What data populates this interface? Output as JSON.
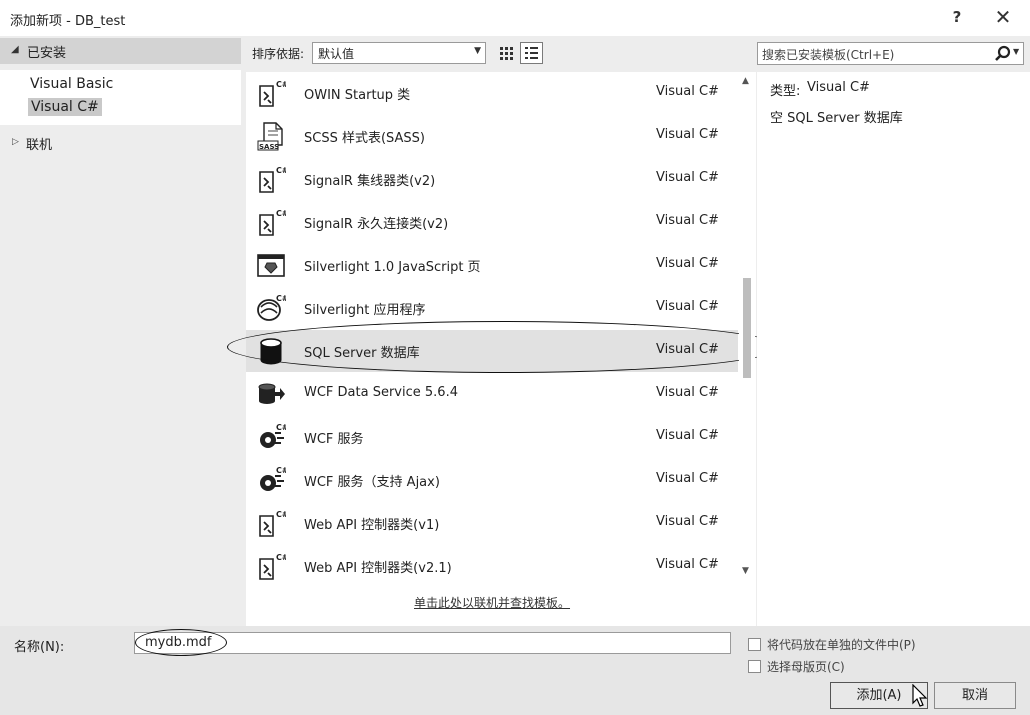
{
  "window": {
    "title": "添加新项 - DB_test",
    "help_label": "?",
    "close_label": "✕"
  },
  "left_panel": {
    "installed_arrow": "◢",
    "installed_label": "已安装",
    "tree_items": [
      "Visual Basic",
      "Visual C#"
    ],
    "selected_item": "Visual C#",
    "online_arrow": "▷",
    "online_label": "联机"
  },
  "toolbar": {
    "sort_label": "排序依据:",
    "sort_value": "默认值",
    "sort_caret": "▼"
  },
  "templates": {
    "items": [
      {
        "name": "OWIN Startup 类",
        "lang": "Visual C#",
        "icon": "csharp-class-icon"
      },
      {
        "name": "SCSS 样式表(SASS)",
        "lang": "Visual C#",
        "icon": "scss-file-icon"
      },
      {
        "name": "SignalR 集线器类(v2)",
        "lang": "Visual C#",
        "icon": "csharp-class-icon"
      },
      {
        "name": "SignalR 永久连接类(v2)",
        "lang": "Visual C#",
        "icon": "csharp-class-icon"
      },
      {
        "name": "Silverlight 1.0 JavaScript 页",
        "lang": "Visual C#",
        "icon": "silverlight-page-icon"
      },
      {
        "name": "Silverlight 应用程序",
        "lang": "Visual C#",
        "icon": "silverlight-app-icon"
      },
      {
        "name": "SQL Server 数据库",
        "lang": "Visual C#",
        "icon": "database-icon"
      },
      {
        "name": "WCF Data Service 5.6.4",
        "lang": "Visual C#",
        "icon": "data-service-icon"
      },
      {
        "name": "WCF 服务",
        "lang": "Visual C#",
        "icon": "wcf-service-icon"
      },
      {
        "name": "WCF 服务（支持 Ajax)",
        "lang": "Visual C#",
        "icon": "wcf-service-icon"
      },
      {
        "name": "Web API 控制器类(v1)",
        "lang": "Visual C#",
        "icon": "csharp-class-icon"
      },
      {
        "name": "Web API 控制器类(v2.1)",
        "lang": "Visual C#",
        "icon": "csharp-class-icon"
      }
    ],
    "selected_index": 6,
    "scroll_up": "▲",
    "scroll_down": "▼",
    "online_link": "单击此处以联机并查找模板。"
  },
  "search": {
    "placeholder": "搜索已安装模板(Ctrl+E)",
    "caret": "▼"
  },
  "description": {
    "type_label": "类型:",
    "type_value": "Visual C#",
    "text": "空 SQL Server 数据库"
  },
  "footer": {
    "name_label": "名称(N):",
    "name_value": "mydb.mdf",
    "checkbox1_label": "将代码放在单独的文件中(P)",
    "checkbox2_label": "选择母版页(C)",
    "add_label": "添加(A)",
    "cancel_label": "取消"
  },
  "colors": {
    "list_bg": "#ffffff",
    "panel_bg": "#ededed",
    "selected_row": "#e1e1e1",
    "tree_selected": "#c9c9c9"
  }
}
